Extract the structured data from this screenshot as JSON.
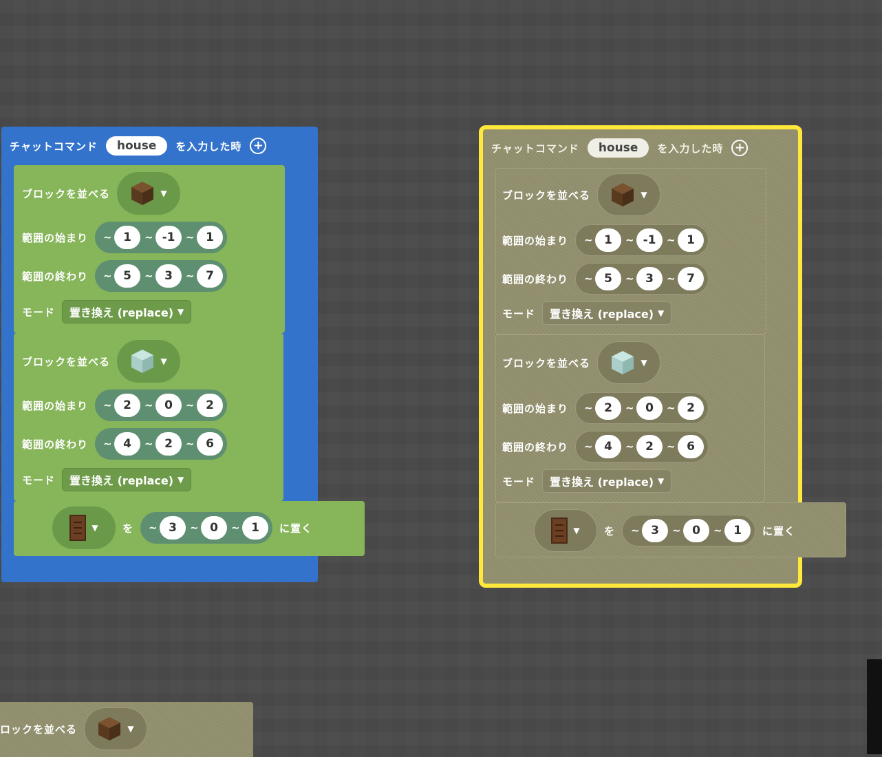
{
  "event": {
    "prefix": "チャットコマンド",
    "command": "house",
    "suffix": "を入力した時",
    "add_icon": "plus-circle-icon"
  },
  "fill1": {
    "label": "ブロックを並べる",
    "block_icon": "dirt-cube-icon",
    "start_label": "範囲の始まり",
    "start": [
      "1",
      "-1",
      "1"
    ],
    "end_label": "範囲の終わり",
    "end": [
      "5",
      "3",
      "7"
    ],
    "mode_label": "モード",
    "mode_value": "置き換え (replace)"
  },
  "fill2": {
    "label": "ブロックを並べる",
    "block_icon": "glass-cube-icon",
    "start_label": "範囲の始まり",
    "start": [
      "2",
      "0",
      "2"
    ],
    "end_label": "範囲の終わり",
    "end": [
      "4",
      "2",
      "6"
    ],
    "mode_label": "モード",
    "mode_value": "置き換え (replace)"
  },
  "place": {
    "block_icon": "door-icon",
    "wo": "を",
    "pos": [
      "3",
      "0",
      "1"
    ],
    "suffix": "に置く"
  },
  "tilde": "~",
  "bottom_fragment": {
    "label": "ロックを並べる",
    "block_icon": "dirt-cube-icon"
  },
  "colors": {
    "event_blue": "#3373cc",
    "block_green": "#87b55a",
    "ghost_olive": "#8e8c6a",
    "highlight_yellow": "#ffe83a",
    "workspace_gray": "#4a4a4a"
  }
}
